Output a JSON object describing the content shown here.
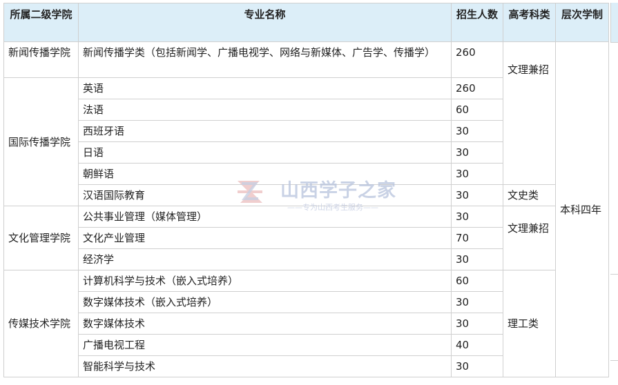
{
  "headers": {
    "college": "所属二级学院",
    "major": "专业名称",
    "enroll": "招生人数",
    "category": "高考科类",
    "level": "层次学制"
  },
  "colleges": [
    "新闻传播学院",
    "国际传播学院",
    "文化管理学院",
    "传媒技术学院"
  ],
  "rows": [
    {
      "major": "新闻传播学类（包括新闻学、广播电视学、网络与新媒体、广告学、传播学）",
      "count": "260"
    },
    {
      "major": "英语",
      "count": "260"
    },
    {
      "major": "法语",
      "count": "60"
    },
    {
      "major": "西班牙语",
      "count": "30"
    },
    {
      "major": "日语",
      "count": "30"
    },
    {
      "major": "朝鲜语",
      "count": "30"
    },
    {
      "major": "汉语国际教育",
      "count": "30"
    },
    {
      "major": "公共事业管理（媒体管理）",
      "count": "30"
    },
    {
      "major": "文化产业管理",
      "count": "70"
    },
    {
      "major": "经济学",
      "count": "30"
    },
    {
      "major": "计算机科学与技术（嵌入式培养）",
      "count": "60"
    },
    {
      "major": "数字媒体技术（嵌入式培养）",
      "count": "30"
    },
    {
      "major": "数字媒体技术",
      "count": "30"
    },
    {
      "major": "广播电视工程",
      "count": "40"
    },
    {
      "major": "智能科学与技术",
      "count": "30"
    }
  ],
  "categories": [
    "文理兼招",
    "文史类",
    "文理兼招",
    "理工类"
  ],
  "level": "本科四年",
  "watermark": {
    "title": "山西学子之家",
    "subtitle": "——专为山西考生服务——"
  }
}
